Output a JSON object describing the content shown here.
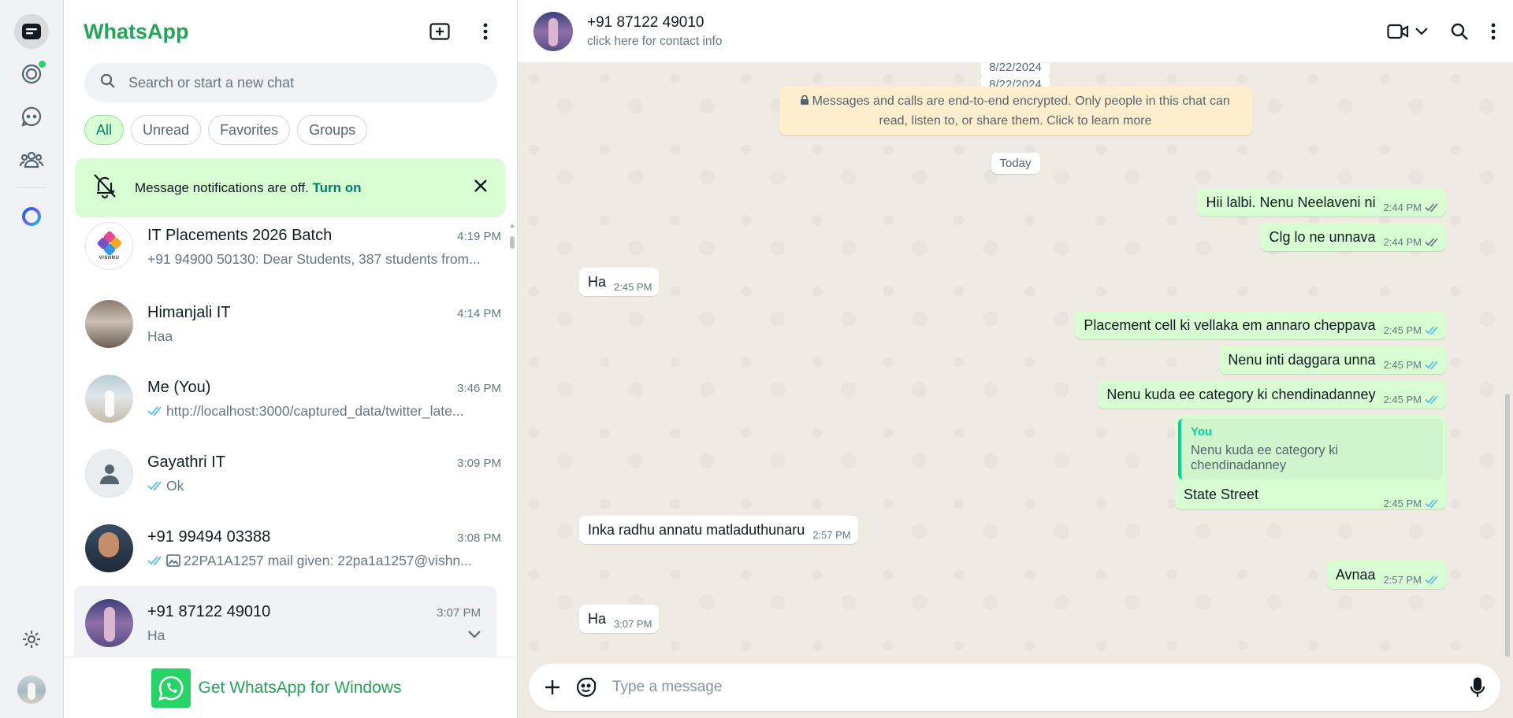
{
  "app": {
    "brand": "WhatsApp"
  },
  "colors": {
    "accent": "#25a45a",
    "bubble_out": "#d9fdd3",
    "bubble_in": "#ffffff",
    "wallpaper": "#efeae2",
    "notice": "#ffeecd",
    "tick_read": "#53bdeb"
  },
  "rail": {
    "items": [
      {
        "name": "chats-icon",
        "active": true
      },
      {
        "name": "status-icon",
        "badge": true
      },
      {
        "name": "channels-icon"
      },
      {
        "name": "communities-icon"
      },
      {
        "name": "meta-ai-icon"
      }
    ],
    "settings_icon": "gear-icon",
    "profile": "profile-avatar"
  },
  "list": {
    "header_icons": [
      "new-chat-icon",
      "menu-dots-icon"
    ],
    "search_placeholder": "Search or start a new chat",
    "filters": [
      "All",
      "Unread",
      "Favorites",
      "Groups"
    ],
    "notification": {
      "text": "Message notifications are off.",
      "link": "Turn on"
    },
    "chats": [
      {
        "name": "IT Placements 2026 Batch",
        "time": "4:19 PM",
        "preview": "+91 94900 50130: Dear Students, 387 students from...",
        "avatar_text": "VISHNU",
        "ticks": false,
        "media": false
      },
      {
        "name": "Himanjali IT",
        "time": "4:14 PM",
        "preview": "Haa",
        "ticks": false,
        "media": false
      },
      {
        "name": "Me (You)",
        "time": "3:46 PM",
        "preview": "http://localhost:3000/captured_data/twitter_late...",
        "ticks": true,
        "media": false
      },
      {
        "name": "Gayathri IT",
        "time": "3:09 PM",
        "preview": "Ok",
        "ticks": true,
        "media": false
      },
      {
        "name": "+91 99494 03388",
        "time": "3:08 PM",
        "preview": "22PA1A1257 mail given: 22pa1a1257@vishn...",
        "ticks": true,
        "media": true
      },
      {
        "name": "+91 87122 49010",
        "time": "3:07 PM",
        "preview": "Ha",
        "ticks": false,
        "media": false,
        "selected": true
      }
    ],
    "footer": "Get WhatsApp for Windows"
  },
  "conversation": {
    "name": "+91 87122 49010",
    "subtitle": "click here for contact info",
    "date_top_partial": "8/22/2024",
    "date_top": "8/22/2024",
    "encryption_notice": "Messages and calls are end-to-end encrypted. Only people in this chat can read, listen to, or share them. Click to learn more",
    "today_label": "Today",
    "messages": [
      {
        "dir": "out",
        "text": "Hii lalbi. Nenu Neelaveni ni",
        "time": "2:44 PM",
        "tick": "delivered"
      },
      {
        "dir": "out",
        "text": "Clg lo ne unnava",
        "time": "2:44 PM",
        "tick": "delivered"
      },
      {
        "dir": "in",
        "text": "Ha",
        "time": "2:45 PM"
      },
      {
        "dir": "out",
        "text": "Placement cell ki vellaka em annaro cheppava",
        "time": "2:45 PM",
        "tick": "read"
      },
      {
        "dir": "out",
        "text": "Nenu inti daggara unna",
        "time": "2:45 PM",
        "tick": "read"
      },
      {
        "dir": "out",
        "text": "Nenu kuda ee category ki chendinadanney",
        "time": "2:45 PM",
        "tick": "read"
      },
      {
        "dir": "out",
        "text": "State Street",
        "time": "2:45 PM",
        "tick": "read",
        "quote_author": "You",
        "quote_text": "Nenu kuda ee category ki chendinadanney"
      },
      {
        "dir": "in",
        "text": "Inka radhu annatu matladuthunaru",
        "time": "2:57 PM"
      },
      {
        "dir": "out",
        "text": "Avnaa",
        "time": "2:57 PM",
        "tick": "read"
      },
      {
        "dir": "in",
        "text": "Ha",
        "time": "3:07 PM"
      }
    ],
    "composer_placeholder": "Type a message"
  }
}
